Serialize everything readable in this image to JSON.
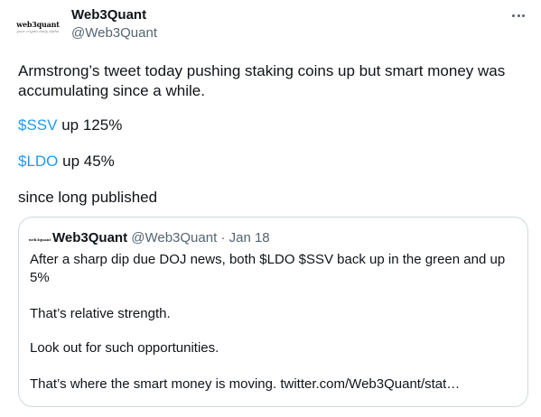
{
  "author": {
    "name": "Web3Quant",
    "handle": "@Web3Quant",
    "avatar_logo": "web3quant",
    "avatar_tagline": "your crypto daily alpha"
  },
  "tweet": {
    "line1": "Armstrong’s tweet today pushing staking coins up but smart money was accumulating since a while.",
    "cashtag1": "$SSV",
    "line2_rest": " up 125%",
    "cashtag2": "$LDO",
    "line3_rest": " up 45%",
    "line4": "since long published"
  },
  "quoted": {
    "name": "Web3Quant",
    "handle": "@Web3Quant",
    "separator": "·",
    "date": "Jan 18",
    "avatar_logo": "web3quant",
    "p1": "After a sharp dip due DOJ news, both $LDO $SSV back up in the green and up 5%",
    "p2": "That’s relative strength.",
    "p3": "Look out for such opportunities.",
    "p4": "That’s where the smart money is moving. twitter.com/Web3Quant/stat…"
  },
  "colors": {
    "link": "#1d9bf0",
    "muted": "#536471",
    "text": "#0f1419",
    "border": "#cfd9de"
  },
  "icons": {
    "more": "more-horizontal-icon"
  }
}
